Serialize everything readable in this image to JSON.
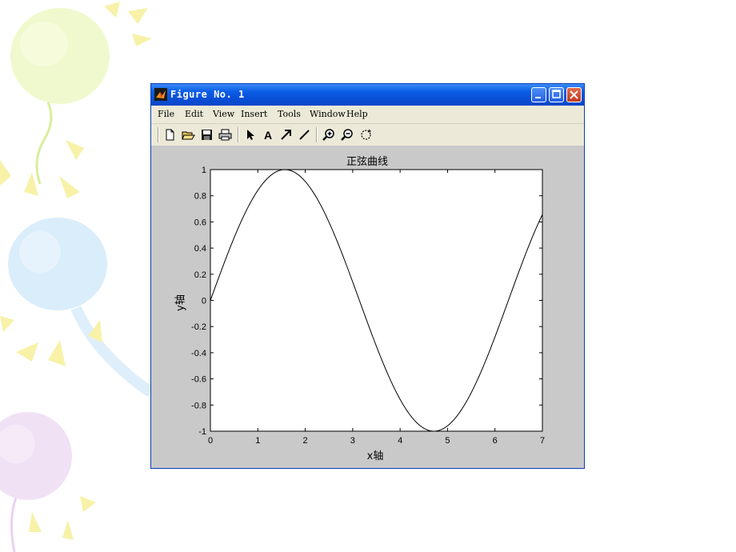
{
  "window": {
    "title": "Figure No. 1",
    "colors": {
      "titlebar": "#0a4fd6",
      "body": "#c9c9c9",
      "menubar": "#ece9d8"
    }
  },
  "menu": {
    "items": [
      {
        "label": "File"
      },
      {
        "label": "Edit"
      },
      {
        "label": "View"
      },
      {
        "label": "Insert"
      },
      {
        "label": "Tools"
      },
      {
        "label": "Window"
      },
      {
        "label": "Help"
      }
    ]
  },
  "toolbar": {
    "icons": [
      "new-file-icon",
      "open-folder-icon",
      "save-icon",
      "print-icon",
      "select-arrow-icon",
      "insert-text-icon",
      "insert-arrow-icon",
      "insert-line-icon",
      "zoom-in-icon",
      "zoom-out-icon",
      "rotate-3d-icon"
    ]
  },
  "chart_data": {
    "type": "line",
    "title": "正弦曲线",
    "xlabel": "x轴",
    "ylabel": "y轴",
    "xlim": [
      0,
      7
    ],
    "ylim": [
      -1,
      1
    ],
    "xticks": [
      "0",
      "1",
      "2",
      "3",
      "4",
      "5",
      "6",
      "7"
    ],
    "yticks": [
      "1",
      "0.8",
      "0.6",
      "0.4",
      "0.2",
      "0",
      "-0.2",
      "-0.4",
      "-0.6",
      "-0.8",
      "-1"
    ],
    "series": [
      {
        "function": "sin(x)",
        "x": [
          0,
          0.5,
          1,
          1.5,
          1.57,
          2,
          2.5,
          3,
          3.5,
          4,
          4.5,
          4.71,
          5,
          5.5,
          6,
          6.5,
          7
        ],
        "values": [
          0,
          0.479,
          0.841,
          0.997,
          1.0,
          0.909,
          0.598,
          0.141,
          -0.351,
          -0.757,
          -0.978,
          -1.0,
          -0.959,
          -0.706,
          -0.279,
          0.215,
          0.657
        ]
      }
    ],
    "grid": false,
    "line_color": "#000000"
  }
}
